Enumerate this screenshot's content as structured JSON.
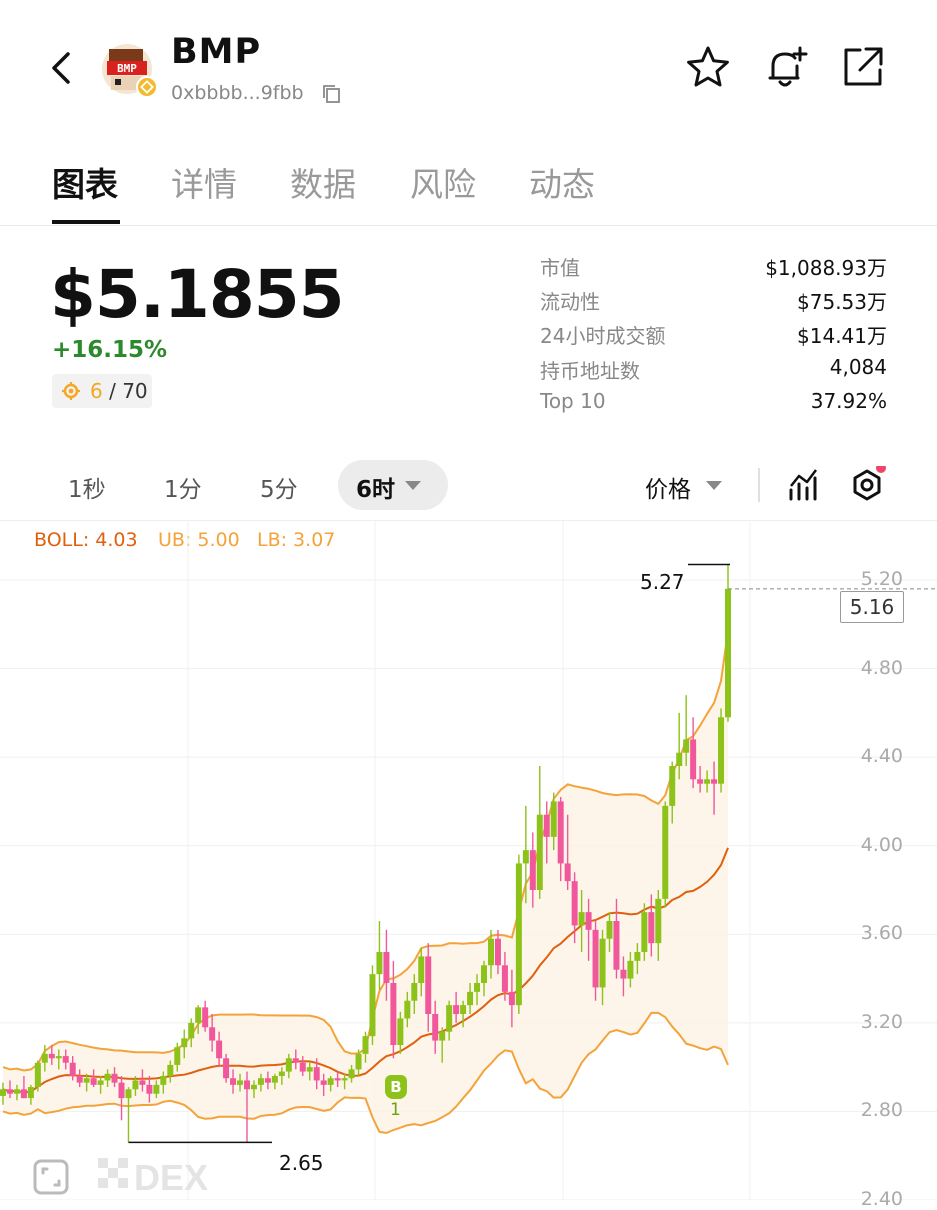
{
  "header": {
    "title": "BMP",
    "address": "0xbbbb...9fbb",
    "logo_text": "BMP"
  },
  "tabs": [
    "图表",
    "详情",
    "数据",
    "风险",
    "动态"
  ],
  "price": {
    "value": "$5.1855",
    "change": "+16.15%",
    "rank": "6",
    "rank_total": "/ 70"
  },
  "stats": [
    {
      "label": "市值",
      "value": "$1,088.93万"
    },
    {
      "label": "流动性",
      "value": "$75.53万"
    },
    {
      "label": "24小时成交额",
      "value": "$14.41万"
    },
    {
      "label": "持币地址数",
      "value": "4,084"
    },
    {
      "label": "Top 10",
      "value": "37.92%"
    }
  ],
  "intervals": [
    "1秒",
    "1分",
    "5分"
  ],
  "interval_active": "6时",
  "price_selector": "价格",
  "indicators": {
    "boll": "BOLL: 4.03",
    "ub": "UB: 5.00",
    "lb": "LB: 3.07"
  },
  "colors": {
    "up": "#8cc21a",
    "down": "#f0589b",
    "boll": "#e0600f",
    "band": "#f3a33a",
    "positive": "#2c8a2c"
  },
  "chart_data": {
    "type": "candlestick",
    "y_ticks": [
      "5.20",
      "4.80",
      "4.40",
      "4.00",
      "3.60",
      "3.20",
      "2.80",
      "2.40"
    ],
    "ylim": [
      2.4,
      5.3
    ],
    "current_price_label": "5.16",
    "high_label": "5.27",
    "low_label": "2.65",
    "buy_marker": {
      "label": "B",
      "count": "1"
    },
    "watermark": "DEX",
    "candles": [
      [
        2.87,
        2.93,
        2.83,
        2.9
      ],
      [
        2.9,
        2.94,
        2.86,
        2.88
      ],
      [
        2.88,
        2.92,
        2.85,
        2.9
      ],
      [
        2.9,
        2.96,
        2.86,
        2.86
      ],
      [
        2.86,
        2.92,
        2.83,
        2.91
      ],
      [
        2.91,
        3.03,
        2.89,
        3.02
      ],
      [
        3.02,
        3.1,
        2.98,
        3.06
      ],
      [
        3.06,
        3.1,
        3.01,
        3.04
      ],
      [
        3.04,
        3.08,
        2.99,
        3.05
      ],
      [
        3.05,
        3.08,
        2.99,
        3.02
      ],
      [
        3.02,
        3.05,
        2.94,
        2.96
      ],
      [
        2.96,
        2.99,
        2.91,
        2.93
      ],
      [
        2.93,
        2.97,
        2.89,
        2.95
      ],
      [
        2.95,
        2.99,
        2.91,
        2.92
      ],
      [
        2.92,
        2.96,
        2.88,
        2.94
      ],
      [
        2.94,
        2.99,
        2.91,
        2.97
      ],
      [
        2.97,
        3.0,
        2.91,
        2.93
      ],
      [
        2.93,
        2.96,
        2.76,
        2.86
      ],
      [
        2.86,
        2.91,
        2.66,
        2.9
      ],
      [
        2.9,
        2.96,
        2.87,
        2.94
      ],
      [
        2.94,
        2.99,
        2.89,
        2.92
      ],
      [
        2.92,
        2.96,
        2.84,
        2.88
      ],
      [
        2.88,
        2.94,
        2.86,
        2.92
      ],
      [
        2.92,
        2.98,
        2.88,
        2.96
      ],
      [
        2.96,
        3.03,
        2.93,
        3.01
      ],
      [
        3.01,
        3.11,
        2.98,
        3.09
      ],
      [
        3.09,
        3.17,
        3.04,
        3.13
      ],
      [
        3.13,
        3.22,
        3.09,
        3.2
      ],
      [
        3.2,
        3.28,
        3.15,
        3.27
      ],
      [
        3.27,
        3.3,
        3.16,
        3.18
      ],
      [
        3.18,
        3.24,
        3.07,
        3.12
      ],
      [
        3.12,
        3.16,
        3.0,
        3.04
      ],
      [
        3.04,
        3.06,
        2.93,
        2.95
      ],
      [
        2.95,
        2.99,
        2.88,
        2.92
      ],
      [
        2.92,
        2.97,
        2.89,
        2.94
      ],
      [
        2.94,
        2.98,
        2.66,
        2.9
      ],
      [
        2.9,
        2.94,
        2.86,
        2.92
      ],
      [
        2.92,
        2.97,
        2.89,
        2.95
      ],
      [
        2.95,
        2.98,
        2.9,
        2.93
      ],
      [
        2.93,
        2.97,
        2.9,
        2.96
      ],
      [
        2.96,
        3.0,
        2.92,
        2.98
      ],
      [
        2.98,
        3.06,
        2.95,
        3.04
      ],
      [
        3.04,
        3.08,
        2.99,
        3.02
      ],
      [
        3.02,
        3.05,
        2.96,
        2.98
      ],
      [
        2.98,
        3.02,
        2.94,
        3.0
      ],
      [
        3.0,
        3.04,
        2.9,
        2.94
      ],
      [
        2.94,
        2.97,
        2.87,
        2.92
      ],
      [
        2.92,
        2.96,
        2.89,
        2.95
      ],
      [
        2.95,
        2.98,
        2.91,
        2.94
      ],
      [
        2.94,
        2.97,
        2.9,
        2.95
      ],
      [
        2.95,
        3.01,
        2.93,
        2.99
      ],
      [
        2.99,
        3.08,
        2.96,
        3.06
      ],
      [
        3.06,
        3.16,
        3.02,
        3.14
      ],
      [
        3.14,
        3.46,
        3.1,
        3.42
      ],
      [
        3.42,
        3.66,
        3.35,
        3.52
      ],
      [
        3.52,
        3.62,
        3.3,
        3.38
      ],
      [
        3.38,
        3.48,
        3.04,
        3.1
      ],
      [
        3.1,
        3.25,
        3.06,
        3.22
      ],
      [
        3.22,
        3.34,
        3.18,
        3.3
      ],
      [
        3.3,
        3.42,
        3.24,
        3.38
      ],
      [
        3.38,
        3.54,
        3.32,
        3.5
      ],
      [
        3.5,
        3.56,
        3.16,
        3.24
      ],
      [
        3.24,
        3.3,
        3.06,
        3.12
      ],
      [
        3.12,
        3.18,
        3.02,
        3.16
      ],
      [
        3.16,
        3.3,
        3.12,
        3.28
      ],
      [
        3.28,
        3.34,
        3.2,
        3.24
      ],
      [
        3.24,
        3.3,
        3.18,
        3.28
      ],
      [
        3.28,
        3.38,
        3.24,
        3.34
      ],
      [
        3.34,
        3.42,
        3.28,
        3.38
      ],
      [
        3.38,
        3.48,
        3.32,
        3.46
      ],
      [
        3.46,
        3.62,
        3.4,
        3.58
      ],
      [
        3.58,
        3.62,
        3.42,
        3.46
      ],
      [
        3.46,
        3.52,
        3.3,
        3.34
      ],
      [
        3.34,
        3.44,
        3.18,
        3.28
      ],
      [
        3.28,
        3.96,
        3.24,
        3.92
      ],
      [
        3.92,
        4.18,
        3.74,
        3.98
      ],
      [
        3.98,
        4.06,
        3.72,
        3.8
      ],
      [
        3.8,
        4.36,
        3.76,
        4.14
      ],
      [
        4.14,
        4.2,
        3.92,
        4.04
      ],
      [
        4.04,
        4.24,
        3.98,
        4.2
      ],
      [
        4.2,
        4.22,
        3.84,
        3.92
      ],
      [
        3.92,
        4.14,
        3.8,
        3.84
      ],
      [
        3.84,
        3.88,
        3.56,
        3.64
      ],
      [
        3.64,
        3.8,
        3.52,
        3.7
      ],
      [
        3.7,
        3.76,
        3.48,
        3.62
      ],
      [
        3.62,
        3.66,
        3.3,
        3.36
      ],
      [
        3.36,
        3.62,
        3.28,
        3.58
      ],
      [
        3.58,
        3.7,
        3.52,
        3.66
      ],
      [
        3.66,
        3.76,
        3.4,
        3.44
      ],
      [
        3.44,
        3.5,
        3.32,
        3.4
      ],
      [
        3.4,
        3.52,
        3.36,
        3.48
      ],
      [
        3.48,
        3.56,
        3.42,
        3.52
      ],
      [
        3.52,
        3.74,
        3.48,
        3.7
      ],
      [
        3.7,
        3.78,
        3.5,
        3.56
      ],
      [
        3.56,
        3.8,
        3.48,
        3.76
      ],
      [
        3.76,
        4.2,
        3.72,
        4.18
      ],
      [
        4.18,
        4.38,
        4.1,
        4.36
      ],
      [
        4.36,
        4.6,
        4.3,
        4.42
      ],
      [
        4.42,
        4.68,
        4.36,
        4.48
      ],
      [
        4.48,
        4.58,
        4.26,
        4.3
      ],
      [
        4.3,
        4.36,
        4.24,
        4.28
      ],
      [
        4.28,
        4.34,
        4.24,
        4.3
      ],
      [
        4.3,
        4.38,
        4.14,
        4.28
      ],
      [
        4.28,
        4.62,
        4.24,
        4.58
      ],
      [
        4.58,
        5.27,
        4.56,
        5.16
      ]
    ]
  }
}
